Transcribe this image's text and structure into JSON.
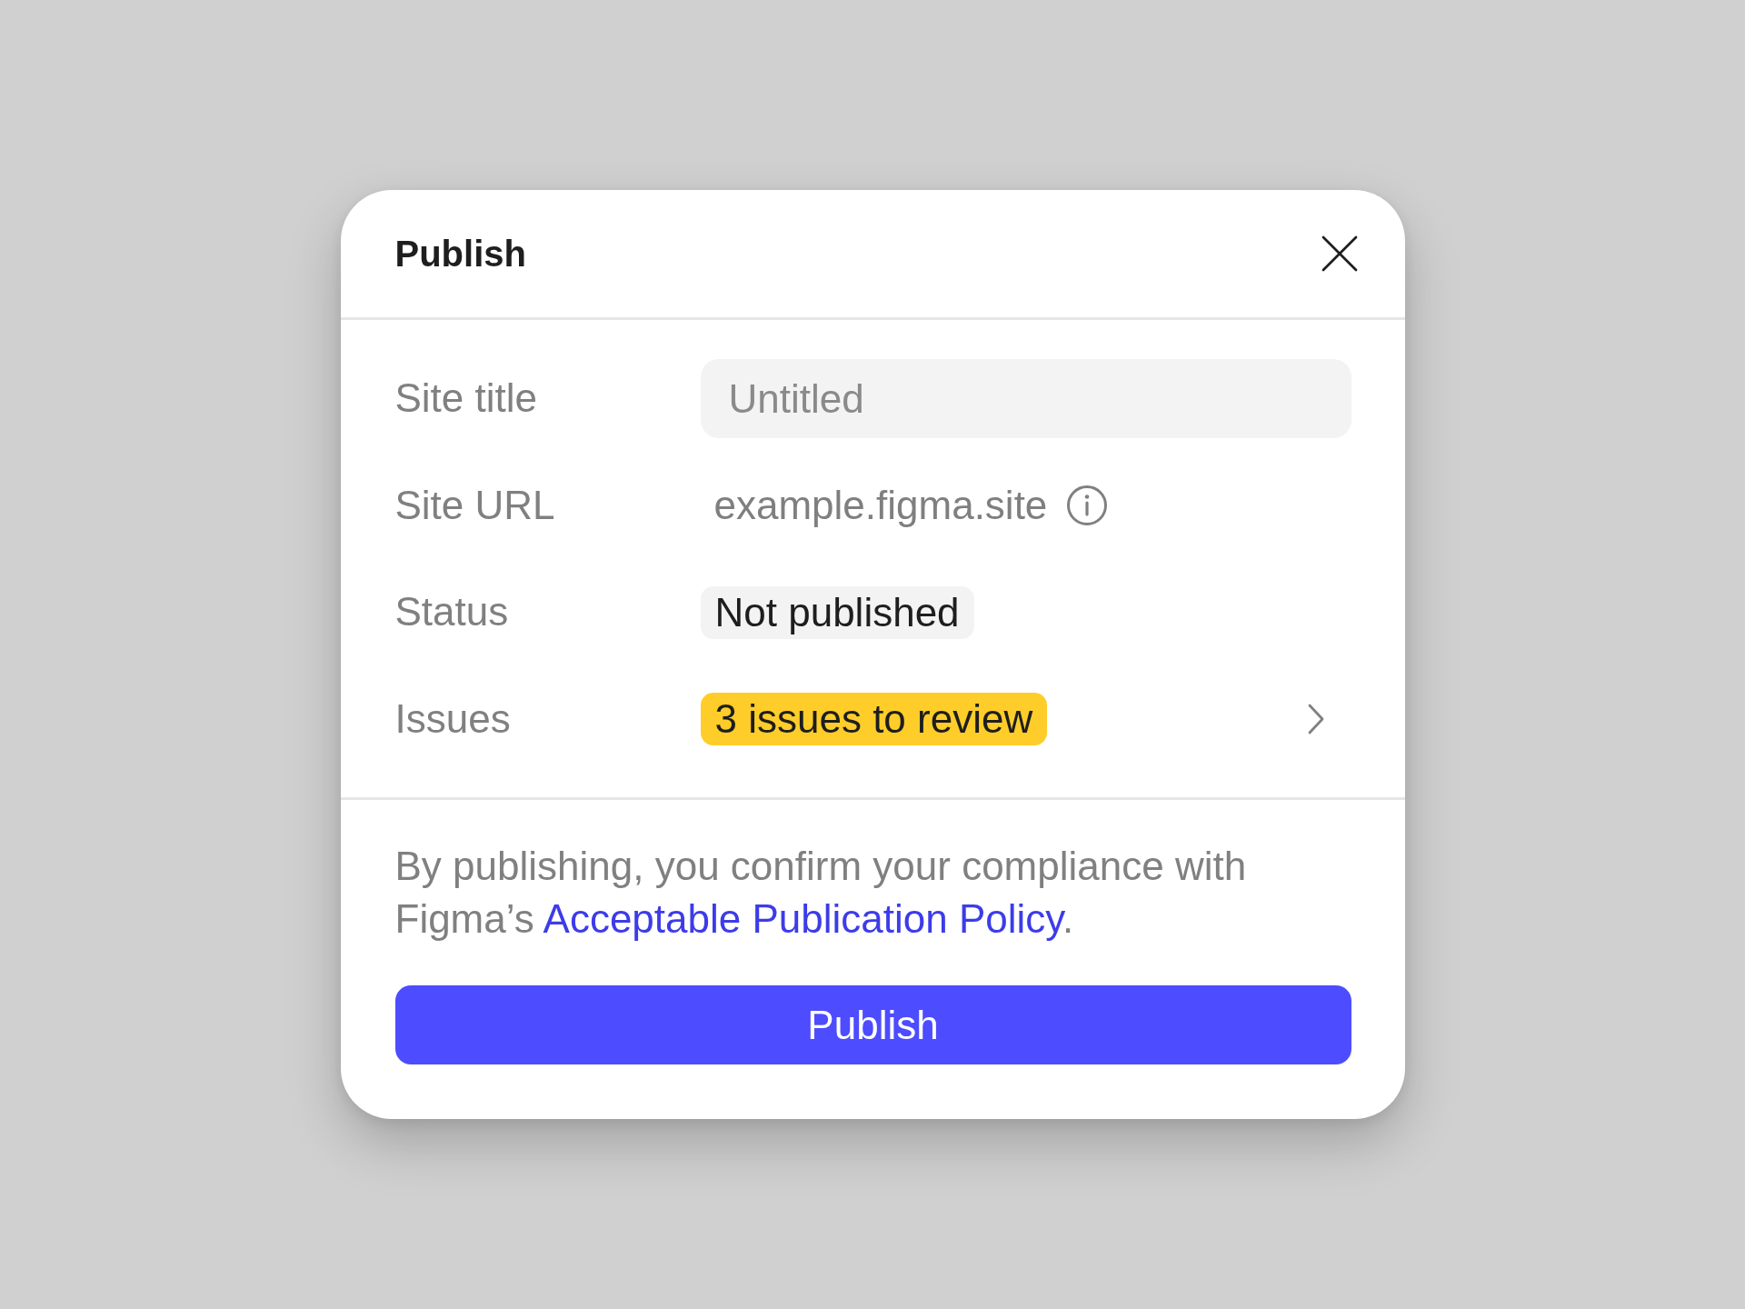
{
  "dialog": {
    "title": "Publish"
  },
  "fields": [
    {
      "kind": "input",
      "label": "Site title",
      "placeholder": "Untitled"
    },
    {
      "kind": "url",
      "label": "Site URL",
      "value": "example.figma.site"
    },
    {
      "kind": "badge",
      "label": "Status",
      "value": "Not published",
      "color": "#f3f3f3"
    },
    {
      "kind": "link_badge",
      "label": "Issues",
      "value": "3 issues to review",
      "color": "#ffcd29"
    }
  ],
  "notice": {
    "text": "By publishing, you confirm your compliance with Figma’s",
    "link": "Acceptable Publication Policy",
    "end": "."
  },
  "primary_button": "Publish"
}
